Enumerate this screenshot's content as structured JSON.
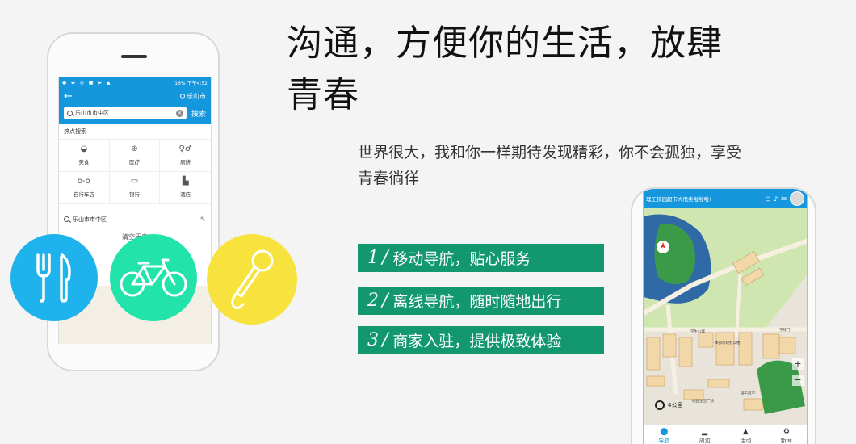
{
  "headline": {
    "line1": "沟通，方便你的生活，放肆",
    "line2": "青春"
  },
  "subline": {
    "line1": "世界很大，我和你一样期待发现精彩，你不会孤独，享受",
    "line2": "青春徜徉"
  },
  "features": [
    {
      "num": "1",
      "slash": "/",
      "text": "移动导航，贴心服务"
    },
    {
      "num": "2",
      "slash": "/",
      "text": "离线导航，随时随地出行"
    },
    {
      "num": "3",
      "slash": "/",
      "text": "商家入驻，提供极致体验"
    }
  ],
  "left_phone": {
    "status_time": "下午4:52",
    "status_battery": "16%",
    "city": "乐山市",
    "search_value": "乐山市市中区",
    "search_button": "搜索",
    "hot_label": "热点搜索",
    "categories": [
      {
        "label": "美食",
        "icon": "bowl-icon"
      },
      {
        "label": "医疗",
        "icon": "medical-icon"
      },
      {
        "label": "厕所",
        "icon": "toilet-icon"
      },
      {
        "label": "自行车店",
        "icon": "bicycle-icon"
      },
      {
        "label": "银行",
        "icon": "bank-icon"
      },
      {
        "label": "酒店",
        "icon": "hotel-icon"
      }
    ],
    "history_item": "乐山市市中区",
    "clear_history": "清空历史"
  },
  "circles": [
    {
      "name": "food",
      "color": "#1eb3ed",
      "icon": "fork-knife-icon"
    },
    {
      "name": "bike",
      "color": "#22e3a9",
      "icon": "bicycle-icon"
    },
    {
      "name": "mic",
      "color": "#f8e33e",
      "icon": "microphone-icon"
    }
  ],
  "right_phone": {
    "marquee": "理工校园超市大甩卖啦啦啦!",
    "distance": "4公里",
    "map_labels": [
      "学生公寓",
      "学校门",
      "本部行政办公楼",
      "校园生活广场",
      "理工超市"
    ],
    "tabs": [
      {
        "label": "导航",
        "icon": "pin-icon",
        "active": true
      },
      {
        "label": "周边",
        "icon": "car-icon",
        "active": false
      },
      {
        "label": "活动",
        "icon": "tree-icon",
        "active": false
      },
      {
        "label": "新闻",
        "icon": "news-icon",
        "active": false
      }
    ]
  },
  "colors": {
    "blue": "#1597de",
    "green_bar": "#13976f",
    "food": "#1eb3ed",
    "bike": "#22e3a9",
    "mic": "#f8e33e"
  }
}
